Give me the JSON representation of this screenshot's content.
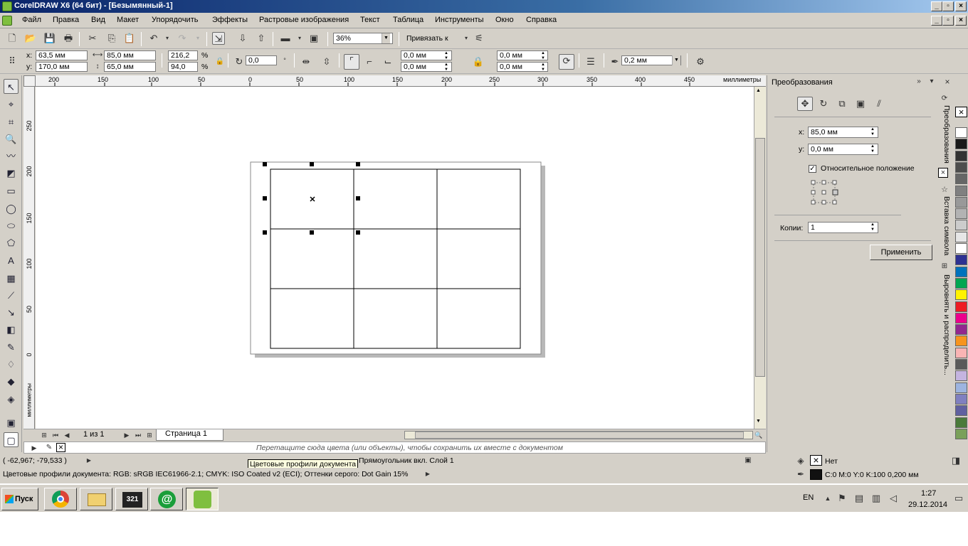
{
  "window": {
    "title": "CorelDRAW X6 (64 бит) - [Безымянный-1]"
  },
  "menu": {
    "items": [
      "Файл",
      "Правка",
      "Вид",
      "Макет",
      "Упорядочить",
      "Эффекты",
      "Растровые изображения",
      "Текст",
      "Таблица",
      "Инструменты",
      "Окно",
      "Справка"
    ]
  },
  "standard_toolbar": {
    "zoom": "36%",
    "snap_label": "Привязать к"
  },
  "property_bar": {
    "x_label": "x:",
    "x_value": "63,5 мм",
    "y_label": "y:",
    "y_value": "170,0 мм",
    "width_value": "85,0 мм",
    "height_value": "65,0 мм",
    "scale_w": "216,2",
    "scale_h": "94,0",
    "percent": "%",
    "rotation": "0,0",
    "corner_top": "0,0 мм",
    "corner_bottom": "0,0 мм",
    "corner_top2": "0,0 мм",
    "corner_bottom2": "0,0 мм",
    "outline_width": "0,2 мм"
  },
  "ruler": {
    "unit": "миллиметры",
    "h_ticks": [
      "200",
      "150",
      "100",
      "50",
      "0",
      "50",
      "100",
      "150",
      "200",
      "250",
      "300",
      "350",
      "400",
      "450"
    ],
    "v_ticks": [
      "250",
      "200",
      "150",
      "100",
      "50",
      "0"
    ]
  },
  "page_nav": {
    "counter": "1 из 1",
    "page_tab": "Страница 1"
  },
  "color_dock": {
    "hint": "Перетащите сюда цвета (или объекты), чтобы сохранить их вместе с документом"
  },
  "status": {
    "coords": "( -62,967; -79,533 )",
    "object_info": "Прямоугольник вкл. Слой 1",
    "tooltip": "Цветовые профили документа",
    "profiles": "Цветовые профили документа: RGB: sRGB IEC61966-2.1; CMYK: ISO Coated v2 (ECI); Оттенки серого: Dot Gain 15%",
    "fill_label": "Нет",
    "outline_label": "C:0 M:0 Y:0 K:100  0,200 мм"
  },
  "docker": {
    "title": "Преобразования",
    "x_label": "x:",
    "x_value": "85,0 мм",
    "y_label": "y:",
    "y_value": "0,0 мм",
    "relative_label": "Относительное положение",
    "relative_checked": true,
    "copies_label": "Копии:",
    "copies_value": "1",
    "apply_label": "Применить"
  },
  "docker_tabs": [
    "Преобразования",
    "Вставка символа",
    "Выровнять и распределить..."
  ],
  "palette": [
    "#ffffff",
    "#1a1a1a",
    "#333333",
    "#4d4d4d",
    "#666666",
    "#808080",
    "#999999",
    "#b3b3b3",
    "#cccccc",
    "#e6e6e6",
    "#ffffff",
    "#2e3192",
    "#0072bc",
    "#00a651",
    "#fff200",
    "#ed1c24",
    "#ec008c",
    "#92278f",
    "#f7941d",
    "#f9b4b4",
    "#5a5a5a",
    "#c4b4e0",
    "#9db4e0",
    "#8080c0",
    "#6060a0",
    "#4a7a3a",
    "#7aa05a"
  ],
  "taskbar": {
    "start_label": "Пуск",
    "lang": "EN",
    "time": "1:27",
    "date": "29.12.2014"
  },
  "colors": {
    "title_gradient_start": "#0a246a",
    "chrome": "#d4d0c8",
    "selection_handle": "#000000"
  }
}
